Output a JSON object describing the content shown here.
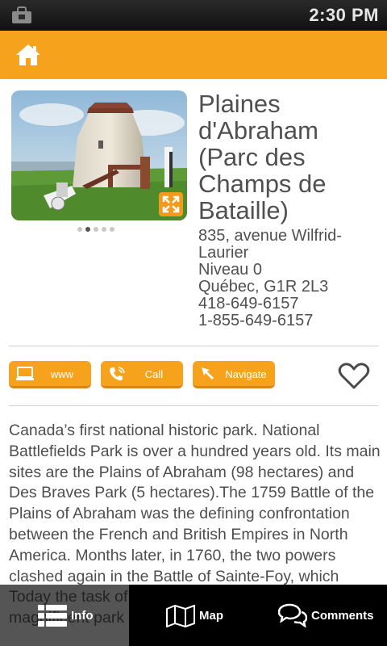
{
  "status_bar": {
    "time": "2:30 PM",
    "notification_icon": "shopping-bag-icon"
  },
  "header": {
    "home_icon": "home-icon",
    "color": "#f6a21d"
  },
  "place": {
    "title": "Plaines d'Abraham (Parc des Champs de Bataille)",
    "address_lines": [
      "835, avenue Wilfrid-",
      "Laurier",
      "Niveau 0",
      "Québec, G1R 2L3",
      "418-649-6157",
      "1-855-649-6157"
    ]
  },
  "gallery": {
    "page_count": 5,
    "active_page": 2,
    "expand_icon": "expand-icon"
  },
  "actions": {
    "www": "www",
    "call": "Call",
    "navigate": "Navigate",
    "favorite_icon": "heart-icon"
  },
  "description": "Canada’s first national historic park. National Battlefields Park is over a hundred years old. Its main sites are the Plains of Abraham (98 hectares) and Des Braves Park (5 hectares).The 1759 Battle of the Plains of Abraham was the defining confrontation between the French and British Empires in North America. Months later, in 1760, the two powers clashed again in the Battle of Sainte-Foy, which Today the task of preserving and enhancing this magnificent park",
  "tabs": {
    "info": "Info",
    "map": "Map",
    "comments": "Comments"
  }
}
